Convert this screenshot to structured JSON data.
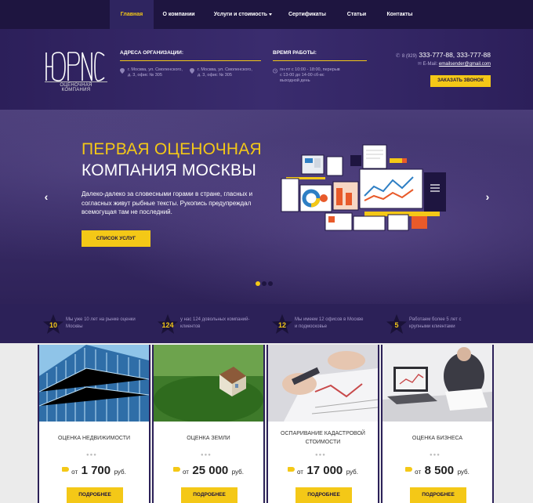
{
  "nav": {
    "items": [
      {
        "label": "Главная",
        "active": true
      },
      {
        "label": "О компании"
      },
      {
        "label": "Услуги и стоимость",
        "dropdown": true
      },
      {
        "label": "Сертификаты"
      },
      {
        "label": "Статьи"
      },
      {
        "label": "Контакты"
      }
    ]
  },
  "header": {
    "logo_text": "ЮРИС",
    "logo_sub": "ОЦЕНОЧНАЯ КОМПАНИЯ",
    "address_title": "АДРЕСА ОРГАНИЗАЦИИ:",
    "address_1": "г. Москва, ул. Смоленского, д. 3, офис № 305",
    "address_2": "г. Москва, ул. Смоленского, д. 3, офис № 305",
    "hours_title": "ВРЕМЯ РАБОТЫ:",
    "hours_text": "пн-пт с 10:00 - 18:00, перерыв с 13-00 до 14-00 сб-вс выходной день",
    "phone_prefix": "8 (929)",
    "phone_numbers": "333-777-88, 333-777-88",
    "email_label": "E-Mail:",
    "email": "emailsender@gmail.com",
    "callback_label": "ЗАКАЗАТЬ ЗВОНОК"
  },
  "hero": {
    "title_line1": "ПЕРВАЯ ОЦЕНОЧНАЯ",
    "title_line2": "КОМПАНИЯ МОСКВЫ",
    "text": "Далеко-далеко за словесными горами в стране, гласных и согласных живут рыбные тексты. Рукопись предупреждал всемогущая там не последний.",
    "button": "СПИСОК УСЛУГ",
    "prev_icon": "chevron-left-icon",
    "next_icon": "chevron-right-icon",
    "slides_total": 3,
    "active_slide": 1
  },
  "stats": [
    {
      "num": "10",
      "text": "Мы уже 10 лет на рынке оценки Москвы"
    },
    {
      "num": "124",
      "text": "у нас 124 довольных компаний-клиентов"
    },
    {
      "num": "12",
      "text": "Мы имеем 12 офисов в Москве и подмосковье"
    },
    {
      "num": "5",
      "text": "Работаем более 5 лет с крупными клиентами"
    }
  ],
  "cards": [
    {
      "title": "ОЦЕНКА НЕДВИЖИМОСТИ",
      "from": "от",
      "price": "1 700",
      "currency": "руб.",
      "button": "ПОДРОБНЕЕ"
    },
    {
      "title": "ОЦЕНКА ЗЕМЛИ",
      "from": "от",
      "price": "25 000",
      "currency": "руб.",
      "button": "ПОДРОБНЕЕ"
    },
    {
      "title": "ОСПАРИВАНИЕ КАДАСТРОВОЙ СТОИМОСТИ",
      "from": "от",
      "price": "17 000",
      "currency": "руб.",
      "button": "ПОДРОБНЕЕ"
    },
    {
      "title": "ОЦЕНКА БИЗНЕСА",
      "from": "от",
      "price": "8 500",
      "currency": "руб.",
      "button": "ПОДРОБНЕЕ"
    }
  ],
  "colors": {
    "accent": "#f4c817",
    "nav_bg": "#1e1540",
    "header_bg": "#2c1f5a",
    "stats_bg": "#2c2158"
  }
}
